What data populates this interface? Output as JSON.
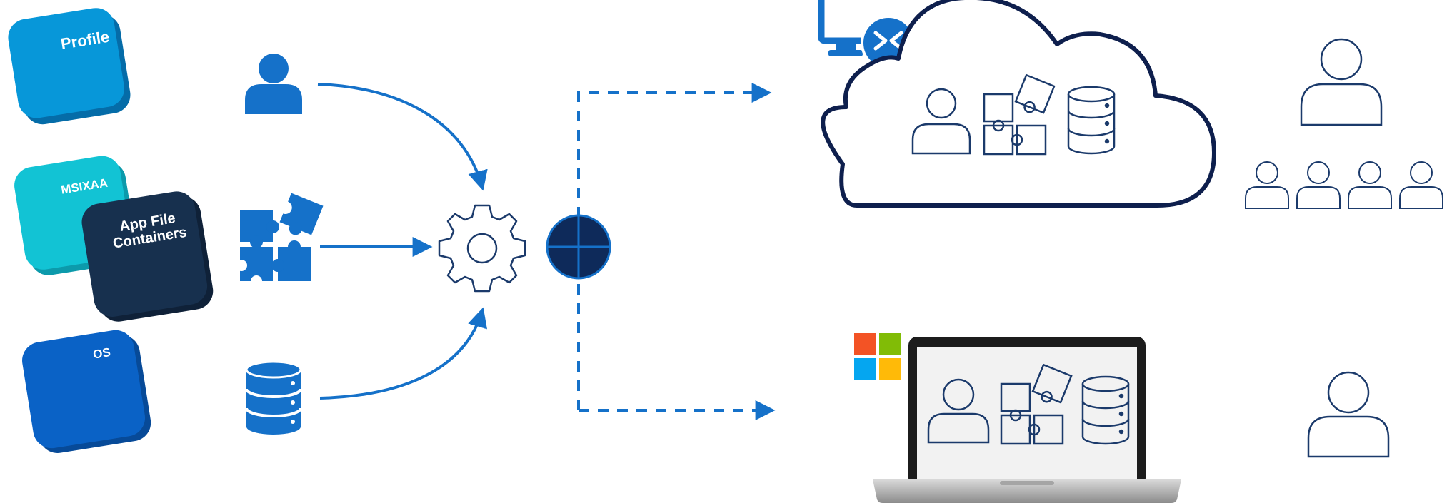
{
  "tiles": {
    "profile": "Profile",
    "msixaa": "MSIXAA",
    "app_file_line1": "App File",
    "app_file_line2": "Containers",
    "os": "OS"
  },
  "colors": {
    "profile_tile": "#0797d9",
    "msixaa_tile": "#12c3d4",
    "app_file_tile": "#17304e",
    "os_tile": "#0a62c6",
    "accent_blue": "#1571c9",
    "cloud_outline": "#0e1f4d",
    "line_icon": "#1b3a6b",
    "globe": "#0e2a5a"
  },
  "icons": [
    "user-icon",
    "puzzle-icon",
    "database-icon",
    "gear-icon",
    "globe-icon",
    "remote-desktop-icon",
    "cloud-icon",
    "laptop-icon",
    "windows-logo-icon"
  ]
}
